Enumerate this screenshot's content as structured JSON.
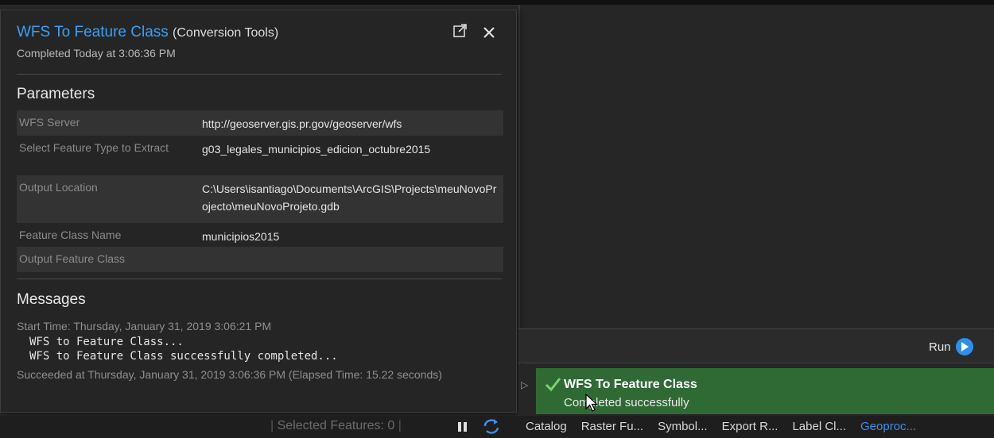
{
  "popup": {
    "tool_name": "WFS To Feature Class",
    "toolbox": "(Conversion Tools)",
    "completed": "Completed Today at 3:06:36 PM",
    "parameters_heading": "Parameters",
    "parameters": [
      {
        "name": "WFS Server",
        "value": "http://geoserver.gis.pr.gov/geoserver/wfs"
      },
      {
        "name": "Select Feature Type to Extract",
        "value": "g03_legales_municipios_edicion_octubre2015"
      },
      {
        "name": "Output Location",
        "value": "C:\\Users\\isantiago\\Documents\\ArcGIS\\Projects\\meuNovoProjecto\\meuNovoProjeto.gdb"
      },
      {
        "name": "Feature Class Name",
        "value": "municipios2015"
      },
      {
        "name": "Output Feature Class",
        "value": ""
      }
    ],
    "messages_heading": "Messages",
    "messages": {
      "start": "Start Time: Thursday, January 31, 2019 3:06:21 PM",
      "line1": "WFS to Feature Class...",
      "line2": "WFS to Feature Class successfully completed...",
      "succeeded": "Succeeded at Thursday, January 31, 2019 3:06:36 PM (Elapsed Time: 15.22 seconds)"
    }
  },
  "run": {
    "label": "Run"
  },
  "status": {
    "title": "WFS To Feature Class",
    "subtitle": "Completed successfully",
    "color": "#2f6a35"
  },
  "statusbar": {
    "selected_features": "Selected Features: 0"
  },
  "tabs": [
    {
      "label": "Catalog"
    },
    {
      "label": "Raster Fu..."
    },
    {
      "label": "Symbol..."
    },
    {
      "label": "Export R..."
    },
    {
      "label": "Label Cl..."
    },
    {
      "label": "Geoproc..."
    }
  ],
  "colors": {
    "accent": "#3aa0f5",
    "success": "#2f6a35",
    "run_button": "#2e8ef0"
  }
}
